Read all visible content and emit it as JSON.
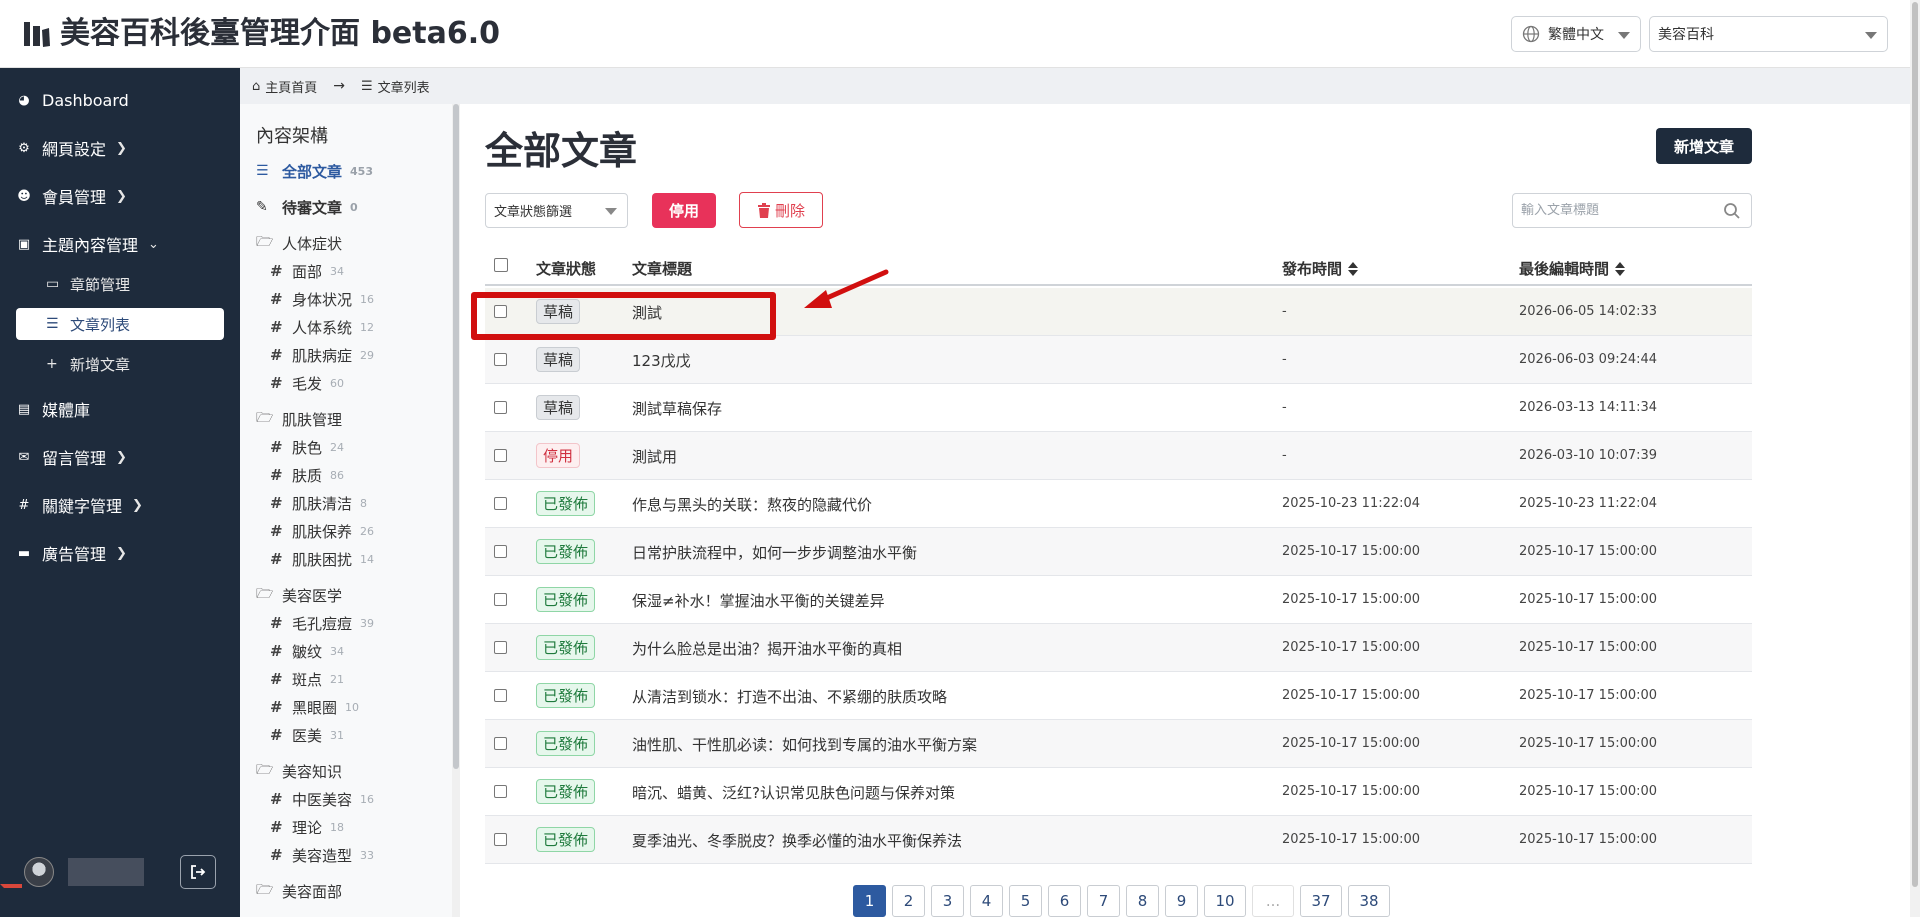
{
  "header": {
    "title": "美容百科後臺管理介面 beta6.0",
    "language": "繁體中文",
    "site": "美容百科"
  },
  "breadcrumb": {
    "home": "主頁首頁",
    "current": "文章列表"
  },
  "sidebar": {
    "items": [
      {
        "label": "Dashboard",
        "icon": "palette-icon"
      },
      {
        "label": "網頁設定",
        "icon": "gear-icon"
      },
      {
        "label": "會員管理",
        "icon": "users-icon"
      },
      {
        "label": "主題內容管理",
        "icon": "book-icon"
      },
      {
        "label": "媒體庫",
        "icon": "images-icon"
      },
      {
        "label": "留言管理",
        "icon": "comment-icon"
      },
      {
        "label": "關鍵字管理",
        "icon": "hash-icon"
      },
      {
        "label": "廣告管理",
        "icon": "ad-icon"
      }
    ],
    "subitems": [
      {
        "label": "章節管理"
      },
      {
        "label": "文章列表"
      },
      {
        "label": "新增文章"
      }
    ]
  },
  "categories": {
    "title": "內容架構",
    "all": {
      "label": "全部文章",
      "count": "453"
    },
    "pending": {
      "label": "待審文章",
      "count": "0"
    },
    "groups": [
      {
        "label": "人体症状",
        "children": [
          {
            "label": "面部",
            "count": "34"
          },
          {
            "label": "身体状况",
            "count": "16"
          },
          {
            "label": "人体系统",
            "count": "12"
          },
          {
            "label": "肌肤病症",
            "count": "29"
          },
          {
            "label": "毛发",
            "count": "60"
          }
        ]
      },
      {
        "label": "肌肤管理",
        "children": [
          {
            "label": "肤色",
            "count": "24"
          },
          {
            "label": "肤质",
            "count": "86"
          },
          {
            "label": "肌肤清洁",
            "count": "8"
          },
          {
            "label": "肌肤保养",
            "count": "26"
          },
          {
            "label": "肌肤困扰",
            "count": "14"
          }
        ]
      },
      {
        "label": "美容医学",
        "children": [
          {
            "label": "毛孔痘痘",
            "count": "39"
          },
          {
            "label": "皺纹",
            "count": "34"
          },
          {
            "label": "斑点",
            "count": "21"
          },
          {
            "label": "黑眼圈",
            "count": "10"
          },
          {
            "label": "医美",
            "count": "31"
          }
        ]
      },
      {
        "label": "美容知识",
        "children": [
          {
            "label": "中医美容",
            "count": "16"
          },
          {
            "label": "理论",
            "count": "18"
          },
          {
            "label": "美容造型",
            "count": "33"
          }
        ]
      },
      {
        "label": "美容面部",
        "children": []
      }
    ]
  },
  "main": {
    "title": "全部文章",
    "add_button": "新增文章",
    "status_filter": "文章狀態篩選",
    "disable_button": "停用",
    "delete_button": "刪除",
    "search_placeholder": "輸入文章標題"
  },
  "table": {
    "headers": {
      "status": "文章狀態",
      "title": "文章標題",
      "published": "發布時間",
      "edited": "最後編輯時間"
    },
    "rows": [
      {
        "status": "草稿",
        "type": "draft",
        "title": "測試",
        "published": "-",
        "edited": "2026-06-05 14:02:33"
      },
      {
        "status": "草稿",
        "type": "draft",
        "title": "123戊戊",
        "published": "-",
        "edited": "2026-06-03 09:24:44"
      },
      {
        "status": "草稿",
        "type": "draft",
        "title": "測試草稿保存",
        "published": "-",
        "edited": "2026-03-13 14:11:34"
      },
      {
        "status": "停用",
        "type": "disabled",
        "title": "測試用",
        "published": "-",
        "edited": "2026-03-10 10:07:39"
      },
      {
        "status": "已發佈",
        "type": "published",
        "title": "作息与黑头的关联：熬夜的隐藏代价",
        "published": "2025-10-23 11:22:04",
        "edited": "2025-10-23 11:22:04"
      },
      {
        "status": "已發佈",
        "type": "published",
        "title": "日常护肤流程中，如何一步步调整油水平衡",
        "published": "2025-10-17 15:00:00",
        "edited": "2025-10-17 15:00:00"
      },
      {
        "status": "已發佈",
        "type": "published",
        "title": "保湿≠补水！掌握油水平衡的关键差异",
        "published": "2025-10-17 15:00:00",
        "edited": "2025-10-17 15:00:00"
      },
      {
        "status": "已發佈",
        "type": "published",
        "title": "为什么脸总是出油？揭开油水平衡的真相",
        "published": "2025-10-17 15:00:00",
        "edited": "2025-10-17 15:00:00"
      },
      {
        "status": "已發佈",
        "type": "published",
        "title": "从清洁到锁水：打造不出油、不紧绷的肤质攻略",
        "published": "2025-10-17 15:00:00",
        "edited": "2025-10-17 15:00:00"
      },
      {
        "status": "已發佈",
        "type": "published",
        "title": "油性肌、干性肌必读：如何找到专属的油水平衡方案",
        "published": "2025-10-17 15:00:00",
        "edited": "2025-10-17 15:00:00"
      },
      {
        "status": "已發佈",
        "type": "published",
        "title": "暗沉、蜡黄、泛红?认识常见肤色问题与保养对策",
        "published": "2025-10-17 15:00:00",
        "edited": "2025-10-17 15:00:00"
      },
      {
        "status": "已發佈",
        "type": "published",
        "title": "夏季油光、冬季脱皮？换季必懂的油水平衡保养法",
        "published": "2025-10-17 15:00:00",
        "edited": "2025-10-17 15:00:00"
      }
    ]
  },
  "pagination": {
    "pages": [
      "1",
      "2",
      "3",
      "4",
      "5",
      "6",
      "7",
      "8",
      "9",
      "10",
      "...",
      "37",
      "38"
    ],
    "current": "1"
  },
  "colors": {
    "sidebar_bg": "#1e2b3c",
    "primary": "#2d5aa0",
    "danger": "#e8325a",
    "annotation": "#d10f0f"
  }
}
